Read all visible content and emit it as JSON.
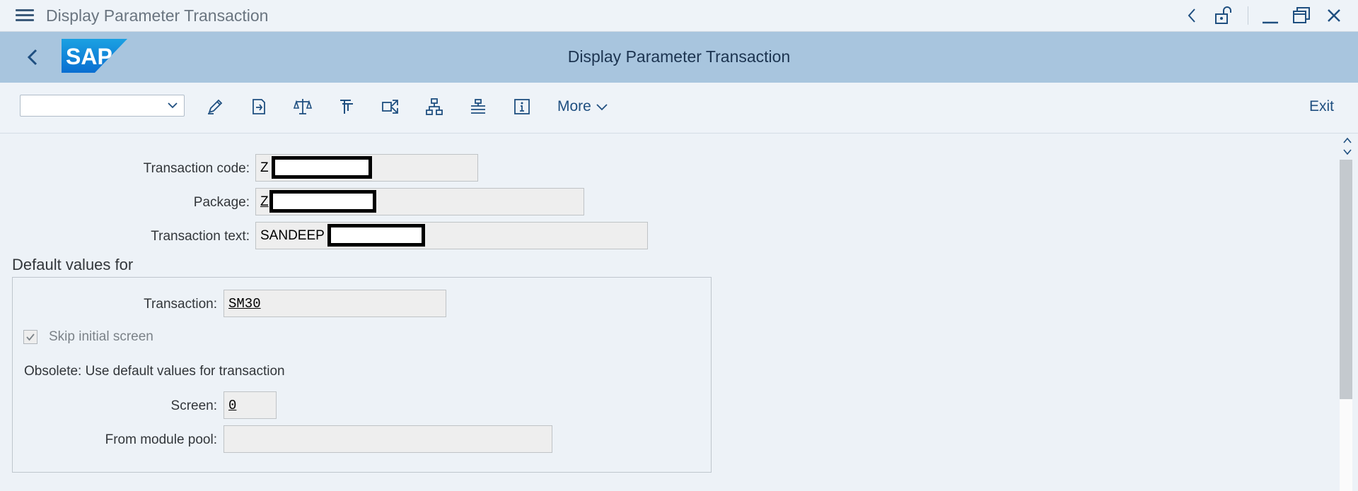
{
  "window": {
    "title": "Display Parameter Transaction"
  },
  "shell": {
    "logo_text": "SAP",
    "page_title": "Display Parameter Transaction"
  },
  "toolbar": {
    "command_field_value": "",
    "icons": [
      "edit-icon",
      "other-object-icon",
      "compare-icon",
      "where-used-icon",
      "navigate-icon",
      "hierarchy-icon",
      "display-object-list-icon",
      "info-icon"
    ],
    "more_label": "More",
    "exit_label": "Exit"
  },
  "form": {
    "transaction_code_label": "Transaction code:",
    "transaction_code_value": "Z",
    "package_label": "Package:",
    "package_value": "Z",
    "transaction_text_label": "Transaction text:",
    "transaction_text_value": "SANDEEP"
  },
  "defaults": {
    "section_title": "Default values for",
    "transaction_label": "Transaction:",
    "transaction_value": "SM30",
    "skip_initial_screen_label": "Skip initial screen",
    "skip_initial_screen_checked": true,
    "obsolete_text": "Obsolete: Use default values for transaction",
    "screen_label": "Screen:",
    "screen_value": "0",
    "module_pool_label": "From module pool:",
    "module_pool_value": ""
  },
  "colors": {
    "shell_bg": "#a8c5de",
    "titlebar_bg": "#eef3f8",
    "content_bg": "#edf2f7",
    "accent": "#1f4f80"
  }
}
